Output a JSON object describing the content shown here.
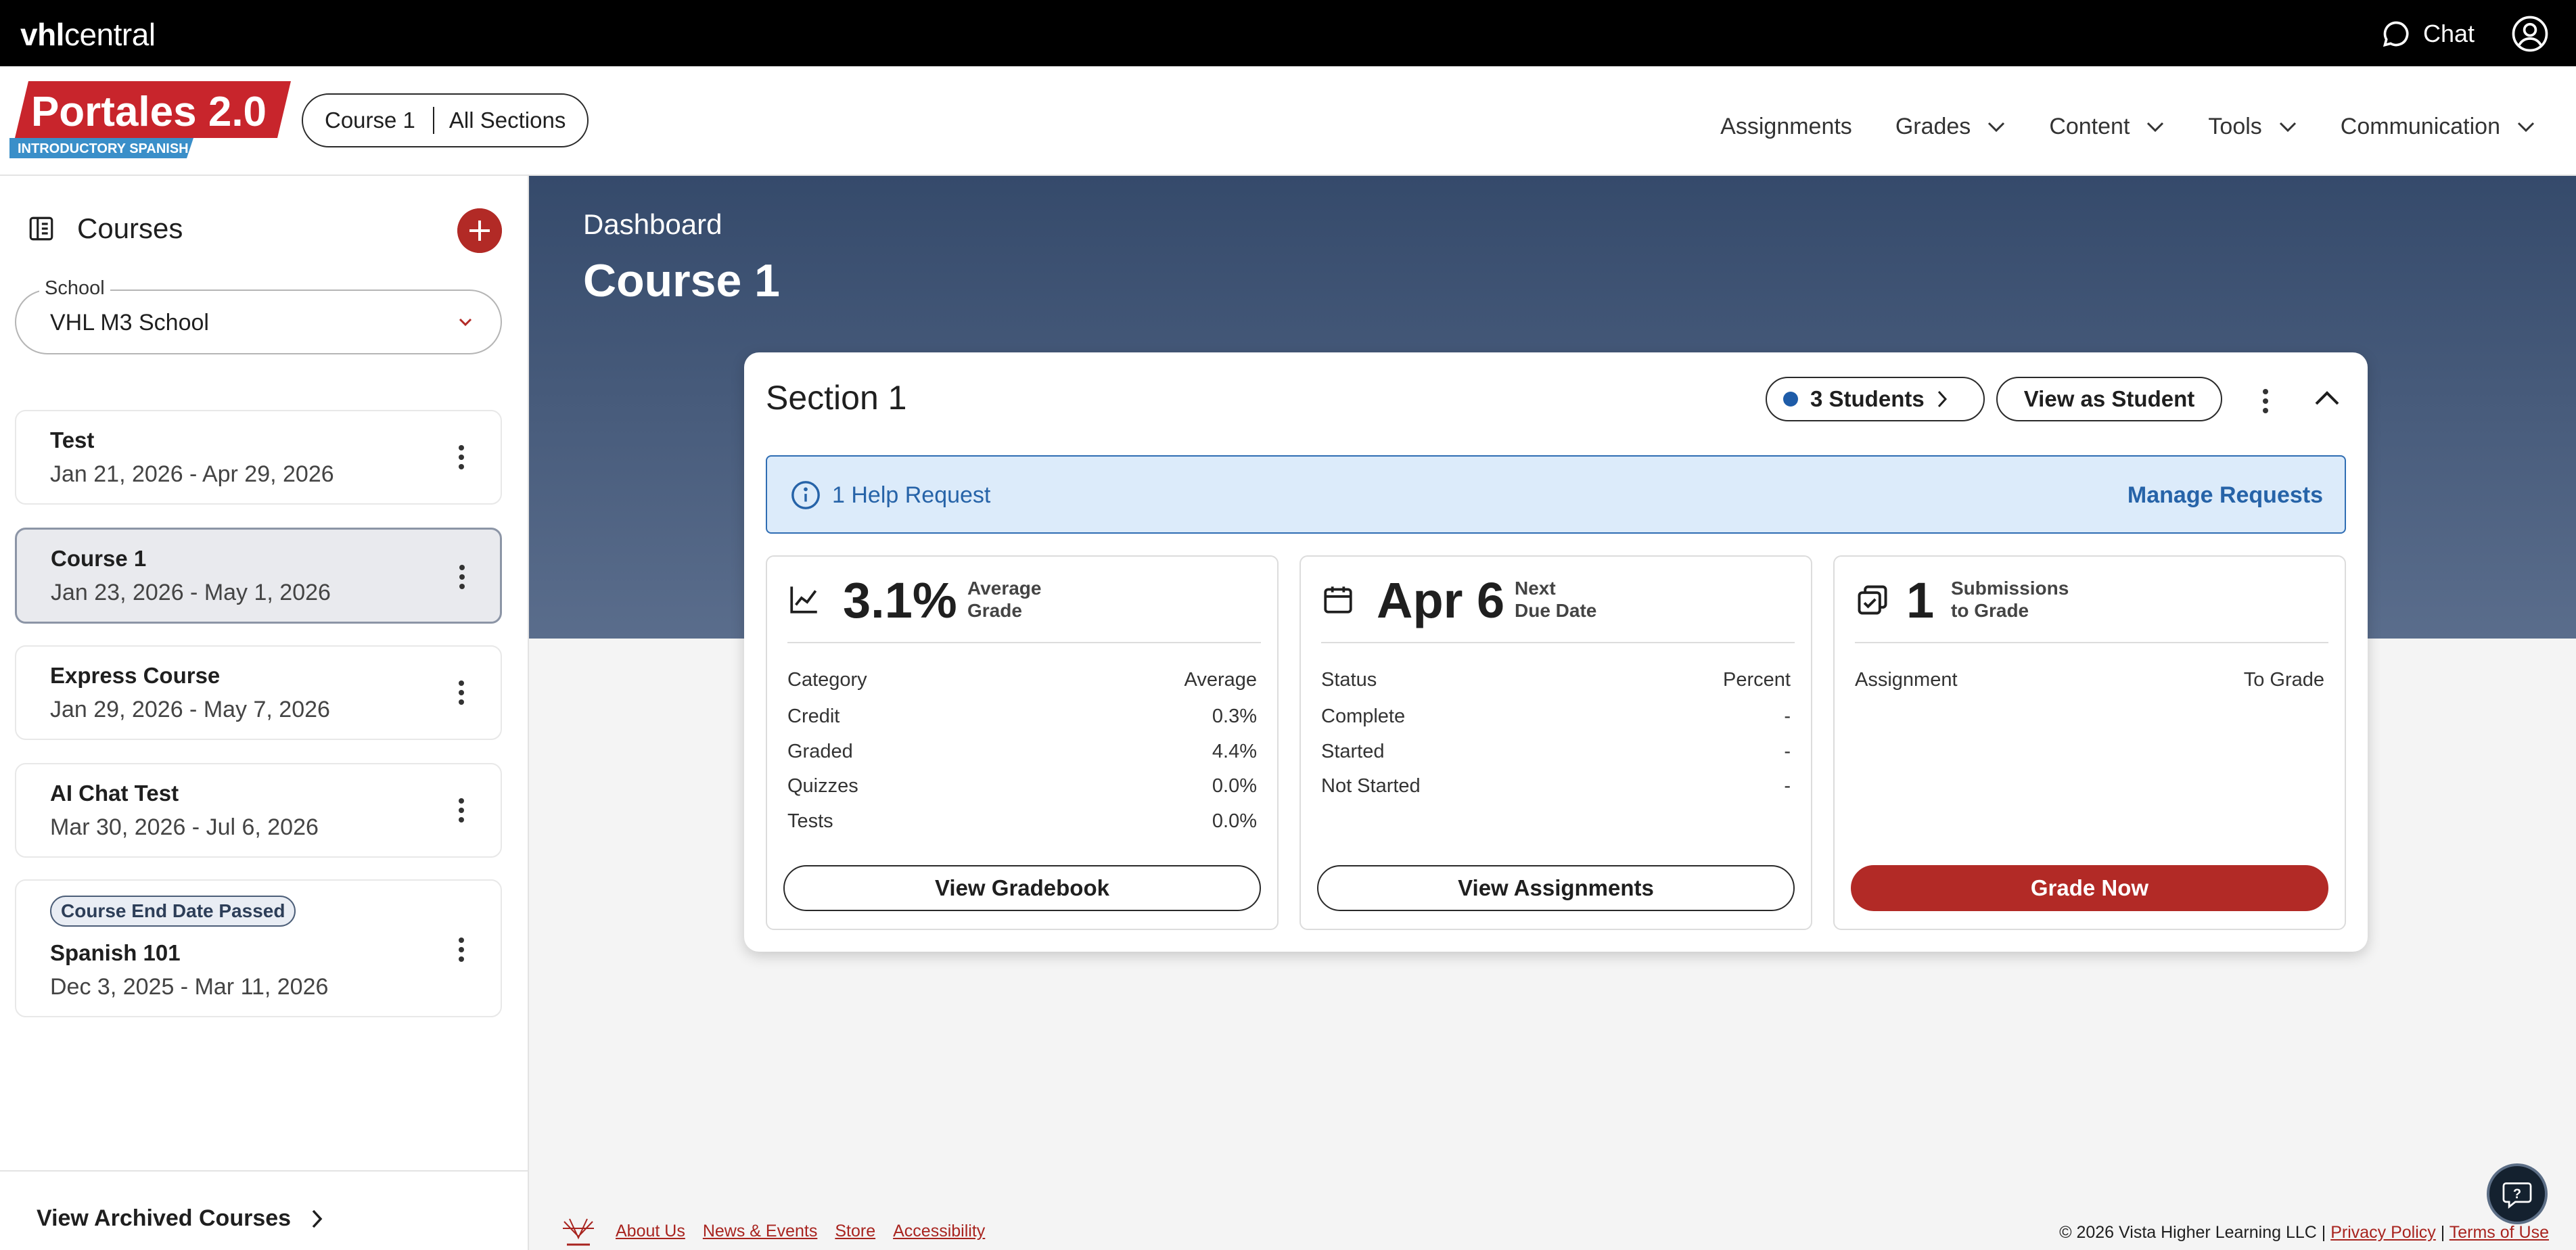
{
  "topbar": {
    "brand_bold": "vhl",
    "brand_rest": "central",
    "chat_label": "Chat"
  },
  "header": {
    "logo_title": "Portales 2.0",
    "logo_sub": "INTRODUCTORY SPANISH",
    "course_selector": {
      "course": "Course 1",
      "section": "All Sections"
    },
    "nav": [
      {
        "label": "Assignments",
        "has_dropdown": false
      },
      {
        "label": "Grades",
        "has_dropdown": true
      },
      {
        "label": "Content",
        "has_dropdown": true
      },
      {
        "label": "Tools",
        "has_dropdown": true
      },
      {
        "label": "Communication",
        "has_dropdown": true
      }
    ]
  },
  "sidebar": {
    "title": "Courses",
    "school": {
      "label": "School",
      "value": "VHL M3 School"
    },
    "courses": [
      {
        "name": "Test",
        "dates": "Jan 21, 2026 - Apr 29, 2026",
        "active": false,
        "badge": ""
      },
      {
        "name": "Course 1",
        "dates": "Jan 23, 2026 - May 1, 2026",
        "active": true,
        "badge": ""
      },
      {
        "name": "Express Course",
        "dates": "Jan 29, 2026 - May 7, 2026",
        "active": false,
        "badge": ""
      },
      {
        "name": "AI Chat Test",
        "dates": "Mar 30, 2026 - Jul 6, 2026",
        "active": false,
        "badge": ""
      },
      {
        "name": "Spanish 101",
        "dates": "Dec 3, 2025 - Mar 11, 2026",
        "active": false,
        "badge": "Course End Date Passed"
      }
    ],
    "archived_label": "View Archived Courses"
  },
  "main": {
    "breadcrumb": "Dashboard",
    "title": "Course 1",
    "section": {
      "title": "Section 1",
      "students_label": "3 Students",
      "view_as_student": "View as Student",
      "alert": {
        "text": "1 Help Request",
        "action": "Manage Requests"
      },
      "cards": {
        "grade": {
          "value": "3.1%",
          "caption_1": "Average",
          "caption_2": "Grade",
          "col_1": "Category",
          "col_2": "Average",
          "rows": [
            {
              "label": "Credit",
              "value": "0.3%"
            },
            {
              "label": "Graded",
              "value": "4.4%"
            },
            {
              "label": "Quizzes",
              "value": "0.0%"
            },
            {
              "label": "Tests",
              "value": "0.0%"
            }
          ],
          "button": "View Gradebook"
        },
        "due": {
          "value": "Apr 6",
          "caption_1": "Next",
          "caption_2": "Due Date",
          "col_1": "Status",
          "col_2": "Percent",
          "rows": [
            {
              "label": "Complete",
              "value": "-"
            },
            {
              "label": "Started",
              "value": "-"
            },
            {
              "label": "Not Started",
              "value": "-"
            }
          ],
          "button": "View Assignments"
        },
        "submissions": {
          "value": "1",
          "caption_1": "Submissions",
          "caption_2": "to Grade",
          "col_1": "Assignment",
          "col_2": "To Grade",
          "button": "Grade Now"
        }
      }
    }
  },
  "footer": {
    "links": [
      "About Us",
      "News & Events",
      "Store",
      "Accessibility"
    ],
    "copyright": "© 2026 Vista Higher Learning LLC",
    "privacy": "Privacy Policy",
    "terms": "Terms of Use"
  },
  "colors": {
    "brand_red": "#b22a26",
    "hero_top": "#354a6b",
    "hero_bottom": "#5a6d8c",
    "info_blue": "#2663a8",
    "info_bg": "#dcebfa"
  }
}
